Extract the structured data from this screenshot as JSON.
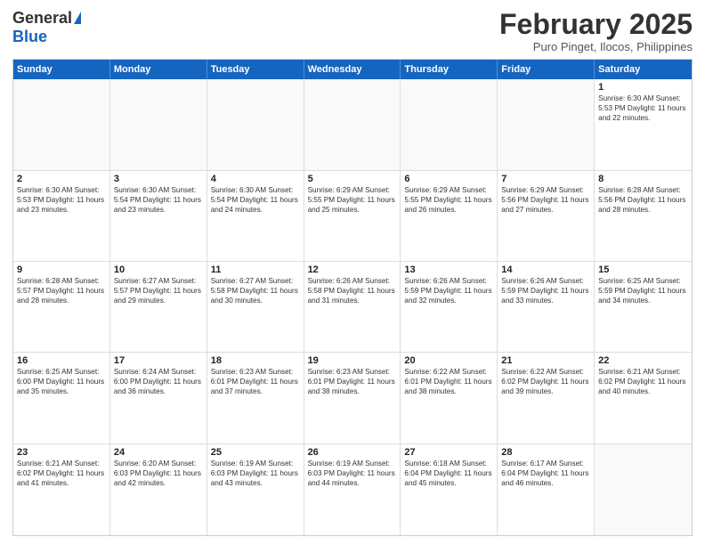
{
  "header": {
    "logo_general": "General",
    "logo_blue": "Blue",
    "main_title": "February 2025",
    "subtitle": "Puro Pinget, Ilocos, Philippines"
  },
  "calendar": {
    "weekdays": [
      "Sunday",
      "Monday",
      "Tuesday",
      "Wednesday",
      "Thursday",
      "Friday",
      "Saturday"
    ],
    "weeks": [
      [
        {
          "day": "",
          "info": ""
        },
        {
          "day": "",
          "info": ""
        },
        {
          "day": "",
          "info": ""
        },
        {
          "day": "",
          "info": ""
        },
        {
          "day": "",
          "info": ""
        },
        {
          "day": "",
          "info": ""
        },
        {
          "day": "1",
          "info": "Sunrise: 6:30 AM\nSunset: 5:53 PM\nDaylight: 11 hours and 22 minutes."
        }
      ],
      [
        {
          "day": "2",
          "info": "Sunrise: 6:30 AM\nSunset: 5:53 PM\nDaylight: 11 hours and 23 minutes."
        },
        {
          "day": "3",
          "info": "Sunrise: 6:30 AM\nSunset: 5:54 PM\nDaylight: 11 hours and 23 minutes."
        },
        {
          "day": "4",
          "info": "Sunrise: 6:30 AM\nSunset: 5:54 PM\nDaylight: 11 hours and 24 minutes."
        },
        {
          "day": "5",
          "info": "Sunrise: 6:29 AM\nSunset: 5:55 PM\nDaylight: 11 hours and 25 minutes."
        },
        {
          "day": "6",
          "info": "Sunrise: 6:29 AM\nSunset: 5:55 PM\nDaylight: 11 hours and 26 minutes."
        },
        {
          "day": "7",
          "info": "Sunrise: 6:29 AM\nSunset: 5:56 PM\nDaylight: 11 hours and 27 minutes."
        },
        {
          "day": "8",
          "info": "Sunrise: 6:28 AM\nSunset: 5:56 PM\nDaylight: 11 hours and 28 minutes."
        }
      ],
      [
        {
          "day": "9",
          "info": "Sunrise: 6:28 AM\nSunset: 5:57 PM\nDaylight: 11 hours and 28 minutes."
        },
        {
          "day": "10",
          "info": "Sunrise: 6:27 AM\nSunset: 5:57 PM\nDaylight: 11 hours and 29 minutes."
        },
        {
          "day": "11",
          "info": "Sunrise: 6:27 AM\nSunset: 5:58 PM\nDaylight: 11 hours and 30 minutes."
        },
        {
          "day": "12",
          "info": "Sunrise: 6:26 AM\nSunset: 5:58 PM\nDaylight: 11 hours and 31 minutes."
        },
        {
          "day": "13",
          "info": "Sunrise: 6:26 AM\nSunset: 5:59 PM\nDaylight: 11 hours and 32 minutes."
        },
        {
          "day": "14",
          "info": "Sunrise: 6:26 AM\nSunset: 5:59 PM\nDaylight: 11 hours and 33 minutes."
        },
        {
          "day": "15",
          "info": "Sunrise: 6:25 AM\nSunset: 5:59 PM\nDaylight: 11 hours and 34 minutes."
        }
      ],
      [
        {
          "day": "16",
          "info": "Sunrise: 6:25 AM\nSunset: 6:00 PM\nDaylight: 11 hours and 35 minutes."
        },
        {
          "day": "17",
          "info": "Sunrise: 6:24 AM\nSunset: 6:00 PM\nDaylight: 11 hours and 36 minutes."
        },
        {
          "day": "18",
          "info": "Sunrise: 6:23 AM\nSunset: 6:01 PM\nDaylight: 11 hours and 37 minutes."
        },
        {
          "day": "19",
          "info": "Sunrise: 6:23 AM\nSunset: 6:01 PM\nDaylight: 11 hours and 38 minutes."
        },
        {
          "day": "20",
          "info": "Sunrise: 6:22 AM\nSunset: 6:01 PM\nDaylight: 11 hours and 38 minutes."
        },
        {
          "day": "21",
          "info": "Sunrise: 6:22 AM\nSunset: 6:02 PM\nDaylight: 11 hours and 39 minutes."
        },
        {
          "day": "22",
          "info": "Sunrise: 6:21 AM\nSunset: 6:02 PM\nDaylight: 11 hours and 40 minutes."
        }
      ],
      [
        {
          "day": "23",
          "info": "Sunrise: 6:21 AM\nSunset: 6:02 PM\nDaylight: 11 hours and 41 minutes."
        },
        {
          "day": "24",
          "info": "Sunrise: 6:20 AM\nSunset: 6:03 PM\nDaylight: 11 hours and 42 minutes."
        },
        {
          "day": "25",
          "info": "Sunrise: 6:19 AM\nSunset: 6:03 PM\nDaylight: 11 hours and 43 minutes."
        },
        {
          "day": "26",
          "info": "Sunrise: 6:19 AM\nSunset: 6:03 PM\nDaylight: 11 hours and 44 minutes."
        },
        {
          "day": "27",
          "info": "Sunrise: 6:18 AM\nSunset: 6:04 PM\nDaylight: 11 hours and 45 minutes."
        },
        {
          "day": "28",
          "info": "Sunrise: 6:17 AM\nSunset: 6:04 PM\nDaylight: 11 hours and 46 minutes."
        },
        {
          "day": "",
          "info": ""
        }
      ]
    ]
  }
}
